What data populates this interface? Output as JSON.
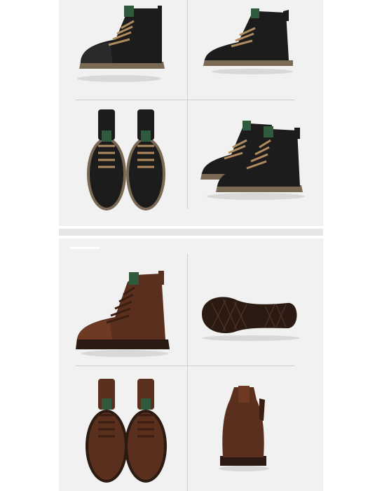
{
  "page": {
    "background": "#ffffff",
    "panel_color": "#f1f1f1",
    "separator_color": "#e6e6e6"
  },
  "sections": [
    {
      "name": "black-boots",
      "leather_color": "#1c1c1c",
      "sole_color": "#7a6a55",
      "lace_color": "#b08b5f",
      "tab_color": "#2f5a3e",
      "views": [
        "side-left",
        "side-right",
        "top-pair",
        "pair-angled"
      ]
    },
    {
      "name": "brown-boots",
      "leather_color": "#5a2f1e",
      "sole_color": "#2a1a12",
      "lace_color": "#5a3020",
      "tab_color": "#2f5a3e",
      "views": [
        "side-left",
        "outsole",
        "top-pair",
        "back"
      ]
    }
  ]
}
